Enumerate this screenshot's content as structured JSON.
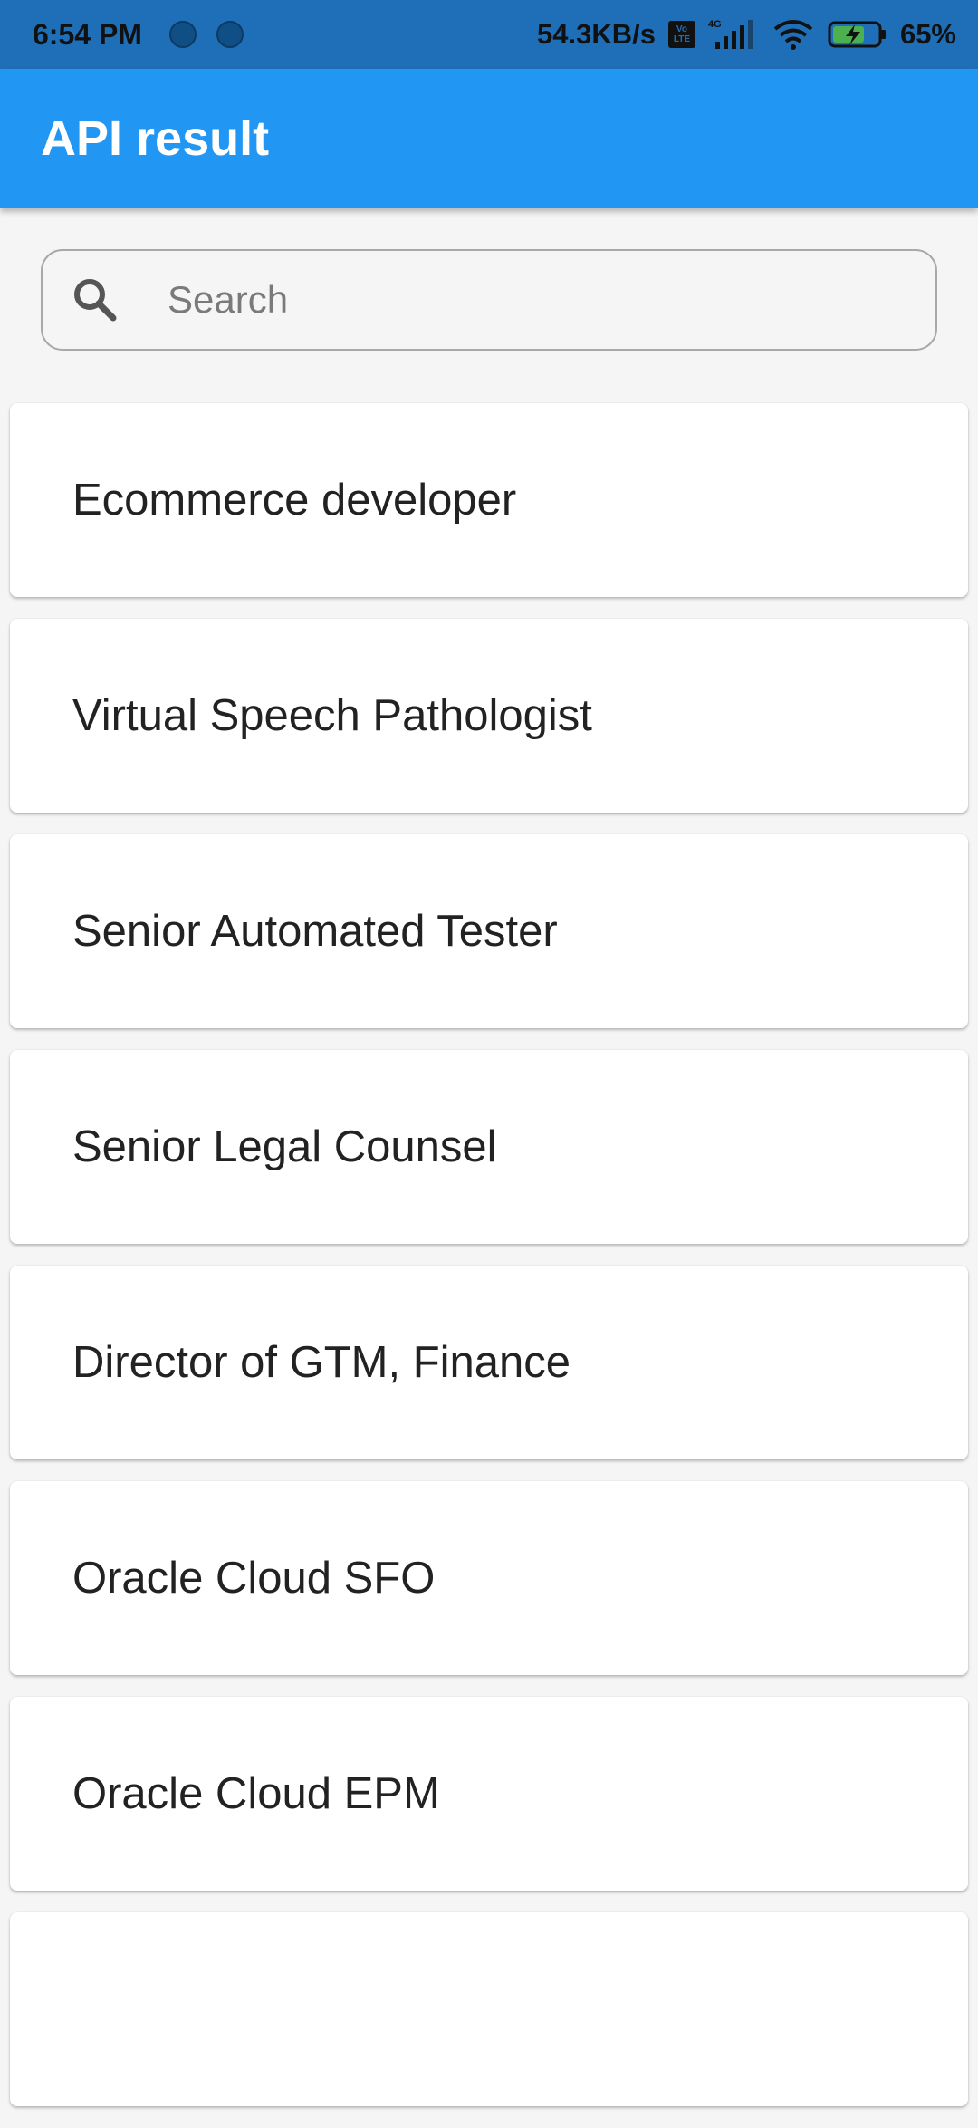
{
  "status_bar": {
    "time": "6:54 PM",
    "network_speed": "54.3KB/s",
    "volte_top": "Vo",
    "volte_bottom": "LTE",
    "network_type": "4G",
    "battery_percent": "65%",
    "icons": [
      "notification-dot-icon",
      "notification-dot-icon",
      "volte-icon",
      "signal-icon",
      "wifi-icon",
      "battery-charging-icon"
    ]
  },
  "app_bar": {
    "title": "API result",
    "color": "#2196f3"
  },
  "search": {
    "placeholder": "Search",
    "value": "",
    "icon": "search-icon"
  },
  "results": [
    {
      "title": "Ecommerce developer"
    },
    {
      "title": "Virtual Speech Pathologist"
    },
    {
      "title": "Senior Automated Tester"
    },
    {
      "title": "Senior Legal Counsel"
    },
    {
      "title": "Director of GTM, Finance"
    },
    {
      "title": "Oracle Cloud SFO"
    },
    {
      "title": "Oracle Cloud EPM"
    },
    {
      "title": ""
    }
  ]
}
